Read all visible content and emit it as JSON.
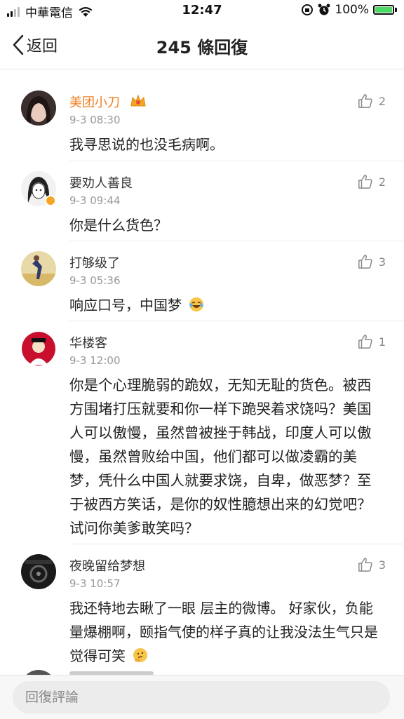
{
  "status_bar": {
    "carrier": "中華電信",
    "time": "12:47",
    "battery": "100%",
    "battery_level": 1.0
  },
  "nav": {
    "back_label": "返回",
    "title": "245 條回復"
  },
  "comments": [
    {
      "name": "美团小刀",
      "time": "9-3 08:30",
      "likes": "2",
      "text": "我寻思说的也没毛病啊。",
      "vip": true,
      "avatar": "avatar-girl"
    },
    {
      "name": "要劝人善良",
      "time": "9-3 09:44",
      "likes": "2",
      "text": "你是什么货色？",
      "verified": true,
      "avatar": "avatar-anime"
    },
    {
      "name": "打够级了",
      "time": "9-3 05:36",
      "likes": "3",
      "text": "响应口号，中国梦",
      "emoji": "laugh-cry-emoji",
      "avatar": "avatar-runner"
    },
    {
      "name": "华楼客",
      "time": "9-3 12:00",
      "likes": "1",
      "text": "你是个心理脆弱的跪奴，无知无耻的货色。被西方围堵打压就要和你一样下跪哭着求饶吗？美国人可以傲慢，虽然曾被挫于韩战，印度人可以傲慢，虽然曾败给中国，他们都可以做凌霸的美梦，凭什么中国人就要求饶，自卑，做恶梦？至于被西方笑话，是你的奴性臆想出来的幻觉吧？试问你美爹敢笑吗？",
      "avatar": "avatar-opera"
    },
    {
      "name": "夜晚留给梦想",
      "time": "9-3 10:57",
      "likes": "3",
      "text": "我还特地去瞅了一眼 层主的微博。 好家伙，负能量爆棚啊，颐指气使的样子真的让我没法生气只是觉得可笑",
      "emoji": "thinking-emoji",
      "avatar": "avatar-car"
    }
  ],
  "reply_input": {
    "placeholder": "回復評論"
  },
  "colors": {
    "vip_name": "#f07f1f",
    "battery_fill": "#4cd964",
    "time_gray": "#999999"
  }
}
